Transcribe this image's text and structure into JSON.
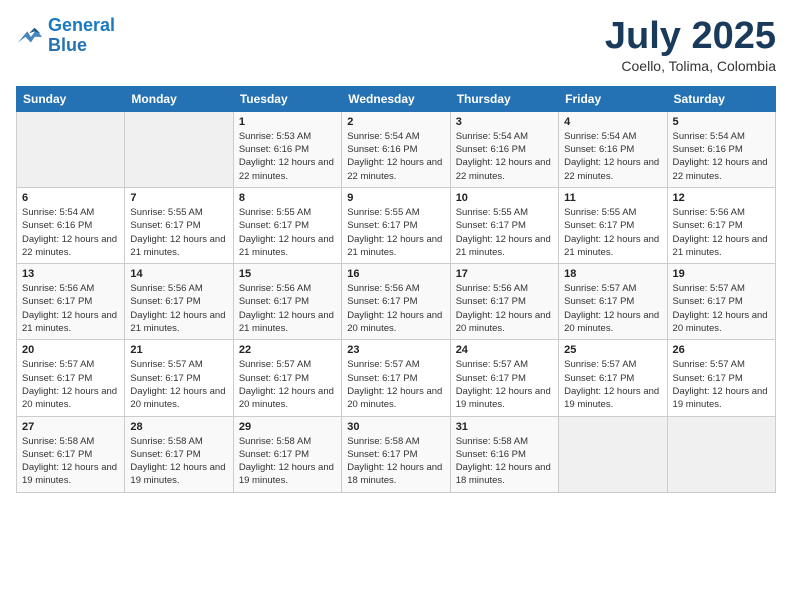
{
  "header": {
    "logo_line1": "General",
    "logo_line2": "Blue",
    "month": "July 2025",
    "location": "Coello, Tolima, Colombia"
  },
  "weekdays": [
    "Sunday",
    "Monday",
    "Tuesday",
    "Wednesday",
    "Thursday",
    "Friday",
    "Saturday"
  ],
  "weeks": [
    [
      {
        "day": "",
        "sunrise": "",
        "sunset": "",
        "daylight": ""
      },
      {
        "day": "",
        "sunrise": "",
        "sunset": "",
        "daylight": ""
      },
      {
        "day": "1",
        "sunrise": "Sunrise: 5:53 AM",
        "sunset": "Sunset: 6:16 PM",
        "daylight": "Daylight: 12 hours and 22 minutes."
      },
      {
        "day": "2",
        "sunrise": "Sunrise: 5:54 AM",
        "sunset": "Sunset: 6:16 PM",
        "daylight": "Daylight: 12 hours and 22 minutes."
      },
      {
        "day": "3",
        "sunrise": "Sunrise: 5:54 AM",
        "sunset": "Sunset: 6:16 PM",
        "daylight": "Daylight: 12 hours and 22 minutes."
      },
      {
        "day": "4",
        "sunrise": "Sunrise: 5:54 AM",
        "sunset": "Sunset: 6:16 PM",
        "daylight": "Daylight: 12 hours and 22 minutes."
      },
      {
        "day": "5",
        "sunrise": "Sunrise: 5:54 AM",
        "sunset": "Sunset: 6:16 PM",
        "daylight": "Daylight: 12 hours and 22 minutes."
      }
    ],
    [
      {
        "day": "6",
        "sunrise": "Sunrise: 5:54 AM",
        "sunset": "Sunset: 6:16 PM",
        "daylight": "Daylight: 12 hours and 22 minutes."
      },
      {
        "day": "7",
        "sunrise": "Sunrise: 5:55 AM",
        "sunset": "Sunset: 6:17 PM",
        "daylight": "Daylight: 12 hours and 21 minutes."
      },
      {
        "day": "8",
        "sunrise": "Sunrise: 5:55 AM",
        "sunset": "Sunset: 6:17 PM",
        "daylight": "Daylight: 12 hours and 21 minutes."
      },
      {
        "day": "9",
        "sunrise": "Sunrise: 5:55 AM",
        "sunset": "Sunset: 6:17 PM",
        "daylight": "Daylight: 12 hours and 21 minutes."
      },
      {
        "day": "10",
        "sunrise": "Sunrise: 5:55 AM",
        "sunset": "Sunset: 6:17 PM",
        "daylight": "Daylight: 12 hours and 21 minutes."
      },
      {
        "day": "11",
        "sunrise": "Sunrise: 5:55 AM",
        "sunset": "Sunset: 6:17 PM",
        "daylight": "Daylight: 12 hours and 21 minutes."
      },
      {
        "day": "12",
        "sunrise": "Sunrise: 5:56 AM",
        "sunset": "Sunset: 6:17 PM",
        "daylight": "Daylight: 12 hours and 21 minutes."
      }
    ],
    [
      {
        "day": "13",
        "sunrise": "Sunrise: 5:56 AM",
        "sunset": "Sunset: 6:17 PM",
        "daylight": "Daylight: 12 hours and 21 minutes."
      },
      {
        "day": "14",
        "sunrise": "Sunrise: 5:56 AM",
        "sunset": "Sunset: 6:17 PM",
        "daylight": "Daylight: 12 hours and 21 minutes."
      },
      {
        "day": "15",
        "sunrise": "Sunrise: 5:56 AM",
        "sunset": "Sunset: 6:17 PM",
        "daylight": "Daylight: 12 hours and 21 minutes."
      },
      {
        "day": "16",
        "sunrise": "Sunrise: 5:56 AM",
        "sunset": "Sunset: 6:17 PM",
        "daylight": "Daylight: 12 hours and 20 minutes."
      },
      {
        "day": "17",
        "sunrise": "Sunrise: 5:56 AM",
        "sunset": "Sunset: 6:17 PM",
        "daylight": "Daylight: 12 hours and 20 minutes."
      },
      {
        "day": "18",
        "sunrise": "Sunrise: 5:57 AM",
        "sunset": "Sunset: 6:17 PM",
        "daylight": "Daylight: 12 hours and 20 minutes."
      },
      {
        "day": "19",
        "sunrise": "Sunrise: 5:57 AM",
        "sunset": "Sunset: 6:17 PM",
        "daylight": "Daylight: 12 hours and 20 minutes."
      }
    ],
    [
      {
        "day": "20",
        "sunrise": "Sunrise: 5:57 AM",
        "sunset": "Sunset: 6:17 PM",
        "daylight": "Daylight: 12 hours and 20 minutes."
      },
      {
        "day": "21",
        "sunrise": "Sunrise: 5:57 AM",
        "sunset": "Sunset: 6:17 PM",
        "daylight": "Daylight: 12 hours and 20 minutes."
      },
      {
        "day": "22",
        "sunrise": "Sunrise: 5:57 AM",
        "sunset": "Sunset: 6:17 PM",
        "daylight": "Daylight: 12 hours and 20 minutes."
      },
      {
        "day": "23",
        "sunrise": "Sunrise: 5:57 AM",
        "sunset": "Sunset: 6:17 PM",
        "daylight": "Daylight: 12 hours and 20 minutes."
      },
      {
        "day": "24",
        "sunrise": "Sunrise: 5:57 AM",
        "sunset": "Sunset: 6:17 PM",
        "daylight": "Daylight: 12 hours and 19 minutes."
      },
      {
        "day": "25",
        "sunrise": "Sunrise: 5:57 AM",
        "sunset": "Sunset: 6:17 PM",
        "daylight": "Daylight: 12 hours and 19 minutes."
      },
      {
        "day": "26",
        "sunrise": "Sunrise: 5:57 AM",
        "sunset": "Sunset: 6:17 PM",
        "daylight": "Daylight: 12 hours and 19 minutes."
      }
    ],
    [
      {
        "day": "27",
        "sunrise": "Sunrise: 5:58 AM",
        "sunset": "Sunset: 6:17 PM",
        "daylight": "Daylight: 12 hours and 19 minutes."
      },
      {
        "day": "28",
        "sunrise": "Sunrise: 5:58 AM",
        "sunset": "Sunset: 6:17 PM",
        "daylight": "Daylight: 12 hours and 19 minutes."
      },
      {
        "day": "29",
        "sunrise": "Sunrise: 5:58 AM",
        "sunset": "Sunset: 6:17 PM",
        "daylight": "Daylight: 12 hours and 19 minutes."
      },
      {
        "day": "30",
        "sunrise": "Sunrise: 5:58 AM",
        "sunset": "Sunset: 6:17 PM",
        "daylight": "Daylight: 12 hours and 18 minutes."
      },
      {
        "day": "31",
        "sunrise": "Sunrise: 5:58 AM",
        "sunset": "Sunset: 6:16 PM",
        "daylight": "Daylight: 12 hours and 18 minutes."
      },
      {
        "day": "",
        "sunrise": "",
        "sunset": "",
        "daylight": ""
      },
      {
        "day": "",
        "sunrise": "",
        "sunset": "",
        "daylight": ""
      }
    ]
  ]
}
